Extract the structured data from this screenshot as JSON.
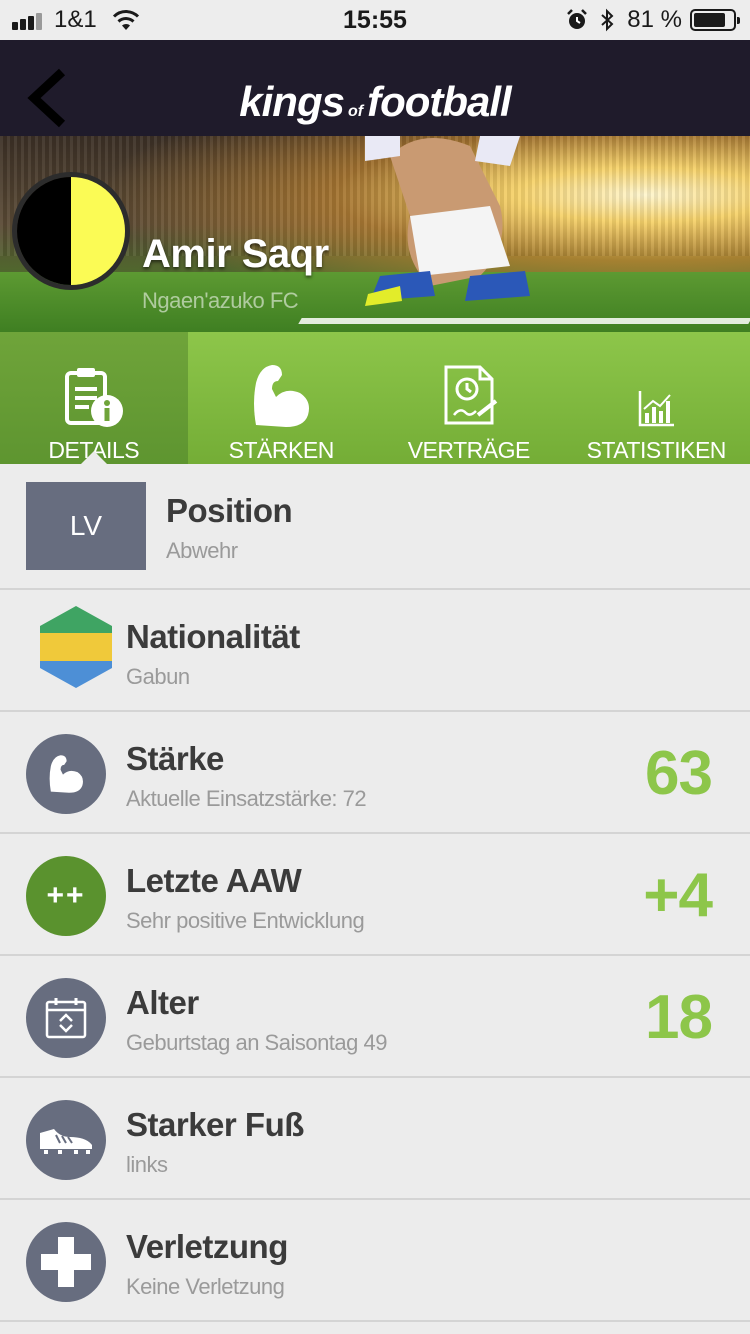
{
  "status_bar": {
    "carrier": "1&1",
    "time": "15:55",
    "battery_percent_label": "81 %",
    "battery_level": 0.81
  },
  "nav": {
    "logo_left": "kings",
    "logo_mid": "of",
    "logo_right": "football"
  },
  "player": {
    "name": "Amir Saqr",
    "club": "Ngaen'azuko FC",
    "club_colors": [
      "#000000",
      "#fbfb55"
    ]
  },
  "tabs": [
    {
      "label": "DETAILS",
      "icon": "document-info-icon",
      "active": true
    },
    {
      "label": "STÄRKEN",
      "icon": "flexed-arm-icon",
      "active": false
    },
    {
      "label": "VERTRÄGE",
      "icon": "contract-icon",
      "active": false
    },
    {
      "label": "STATISTIKEN",
      "icon": "bar-chart-icon",
      "active": false
    }
  ],
  "rows": {
    "position": {
      "badge": "LV",
      "title": "Position",
      "subtitle": "Abwehr"
    },
    "nationality": {
      "title": "Nationalität",
      "subtitle": "Gabun",
      "flag_colors": [
        "#3fa463",
        "#f0c93a",
        "#4d8fd6"
      ]
    },
    "strength": {
      "title": "Stärke",
      "subtitle": "Aktuelle Einsatzstärke: 72",
      "value": "63",
      "icon": "flexed-arm-icon"
    },
    "last_aaw": {
      "title": "Letzte AAW",
      "subtitle": "Sehr positive Entwicklung",
      "value": "+4",
      "badge": "++"
    },
    "age": {
      "title": "Alter",
      "subtitle": "Geburtstag an Saisontag 49",
      "value": "18",
      "icon": "calendar-icon"
    },
    "foot": {
      "title": "Starker Fuß",
      "subtitle": "links",
      "icon": "football-boot-icon"
    },
    "injury": {
      "title": "Verletzung",
      "subtitle": "Keine Verletzung",
      "icon": "plus-cross-icon"
    }
  },
  "colors": {
    "accent_green": "#8dc64a",
    "nav_bg": "#1f1b2b",
    "icon_circle": "#676d7f"
  }
}
